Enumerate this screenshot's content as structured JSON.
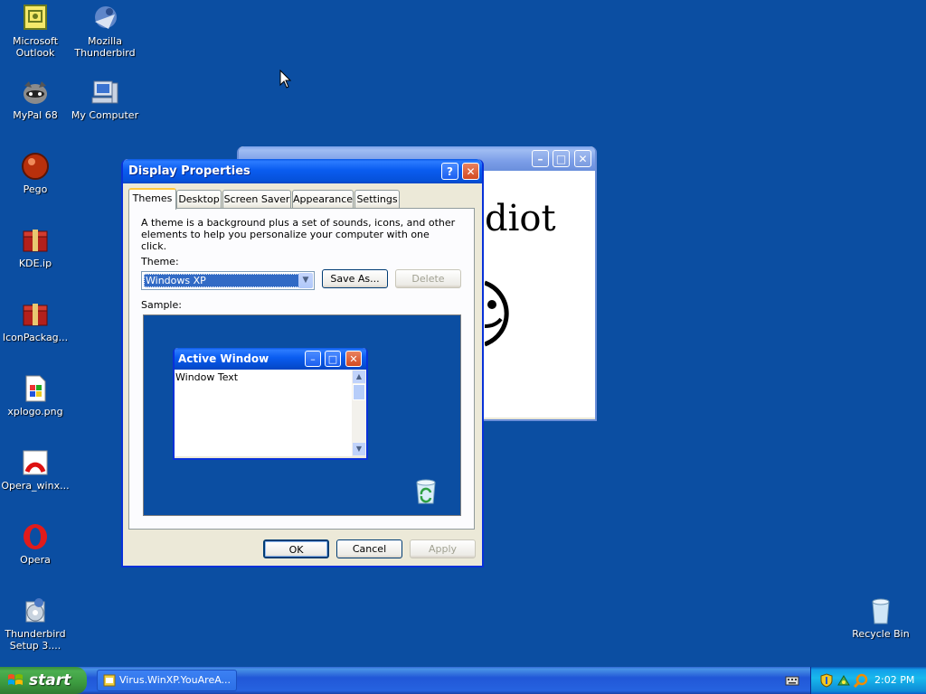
{
  "desktop": {
    "icons": [
      {
        "label": "Microsoft\nOutlook",
        "l1": "Microsoft",
        "l2": "Outlook"
      },
      {
        "label": "Mozilla Thunderbird",
        "l1": "Mozilla",
        "l2": "Thunderbird"
      },
      {
        "label": "MyPal 68"
      },
      {
        "label": "My Computer"
      },
      {
        "label": "Pego"
      },
      {
        "label": "KDE.ip"
      },
      {
        "label": "IconPackag..."
      },
      {
        "label": "xplogo.png"
      },
      {
        "label": "Opera_winx..."
      },
      {
        "label": "Opera"
      },
      {
        "l1": "Thunderbird",
        "l2": "Setup 3...."
      },
      {
        "label": "Recycle Bin"
      }
    ]
  },
  "bg_window": {
    "content_text": "diot"
  },
  "dialog": {
    "title": "Display Properties",
    "tabs": [
      "Themes",
      "Desktop",
      "Screen Saver",
      "Appearance",
      "Settings"
    ],
    "description": "A theme is a background plus a set of sounds, icons, and other elements to help you personalize your computer with one click.",
    "theme_label": "Theme:",
    "theme_value": "Windows XP",
    "save_as": "Save As...",
    "delete": "Delete",
    "sample_label": "Sample:",
    "sample": {
      "window_title": "Active Window",
      "window_text": "Window Text"
    },
    "ok": "OK",
    "cancel": "Cancel",
    "apply": "Apply"
  },
  "taskbar": {
    "start_label": "start",
    "task_label": "Virus.WinXP.YouAreA...",
    "clock": "2:02 PM"
  },
  "colors": {
    "desktop": "#0b4ea2",
    "title_bar": "#0a5cf0",
    "start_button": "#3c9a3f",
    "tray": "#139ee9"
  }
}
